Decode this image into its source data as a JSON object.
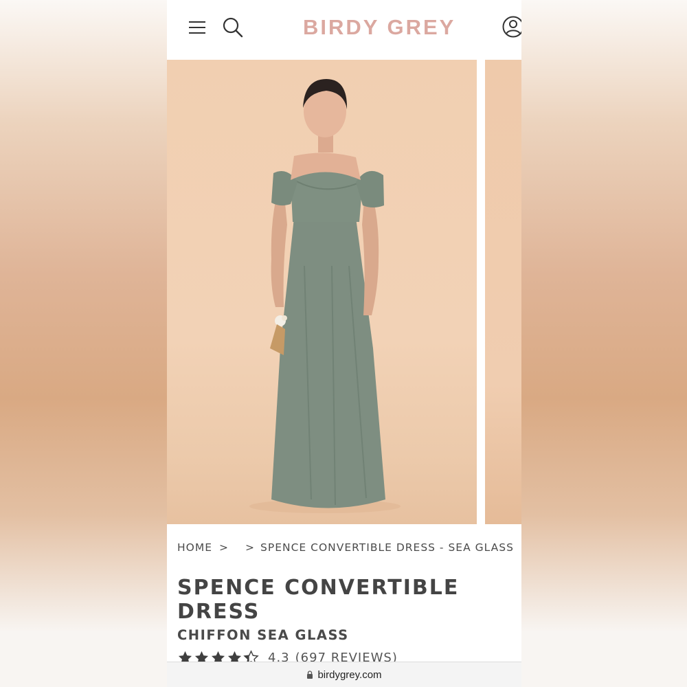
{
  "header": {
    "brand": "BIRDY GREY",
    "brand_color": "#dba8a0",
    "icons": [
      "menu-icon",
      "search-icon",
      "account-icon"
    ]
  },
  "gallery": {
    "main_image": "woman-in-sea-glass-off-shoulder-dress",
    "next_image_peek": "dress-photo-2"
  },
  "breadcrumb": {
    "home": "HOME",
    "sep1": ">",
    "sep2": ">",
    "current": "SPENCE CONVERTIBLE DRESS - SEA GLASS"
  },
  "product": {
    "title": "SPENCE CONVERTIBLE DRESS",
    "subtitle": "CHIFFON SEA GLASS",
    "rating": 4.3,
    "rating_value_text": "4.3",
    "reviews_text": "(697 REVIEWS)"
  },
  "browser": {
    "url": "birdygrey.com"
  }
}
